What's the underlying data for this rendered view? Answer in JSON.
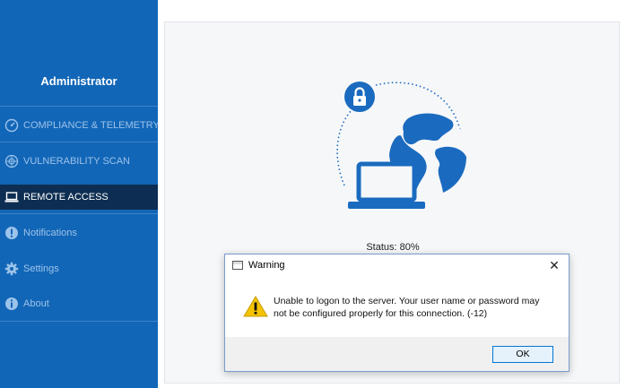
{
  "sidebar": {
    "title": "Administrator",
    "items": [
      {
        "label": "COMPLIANCE & TELEMETRY",
        "icon": "speedometer-icon"
      },
      {
        "label": "VULNERABILITY SCAN",
        "icon": "radar-icon"
      },
      {
        "label": "REMOTE ACCESS",
        "icon": "laptop-icon",
        "active": true
      },
      {
        "label": "Notifications",
        "icon": "info-circle-icon"
      },
      {
        "label": "Settings",
        "icon": "gear-icon"
      },
      {
        "label": "About",
        "icon": "info-icon"
      }
    ]
  },
  "main": {
    "status": "Status: 80%",
    "hero_icons": [
      "lock-icon",
      "globe-icon",
      "laptop-icon"
    ]
  },
  "dialog": {
    "title": "Warning",
    "close": "✕",
    "message": "Unable to logon to the server. Your user name or password may not be configured properly for this connection. (-12)",
    "ok_label": "OK"
  },
  "colors": {
    "sidebar_bg": "#1266b7",
    "sidebar_active_bg": "#0d2e52",
    "accent": "#1a6bbf",
    "warning_yellow": "#f5c400"
  }
}
